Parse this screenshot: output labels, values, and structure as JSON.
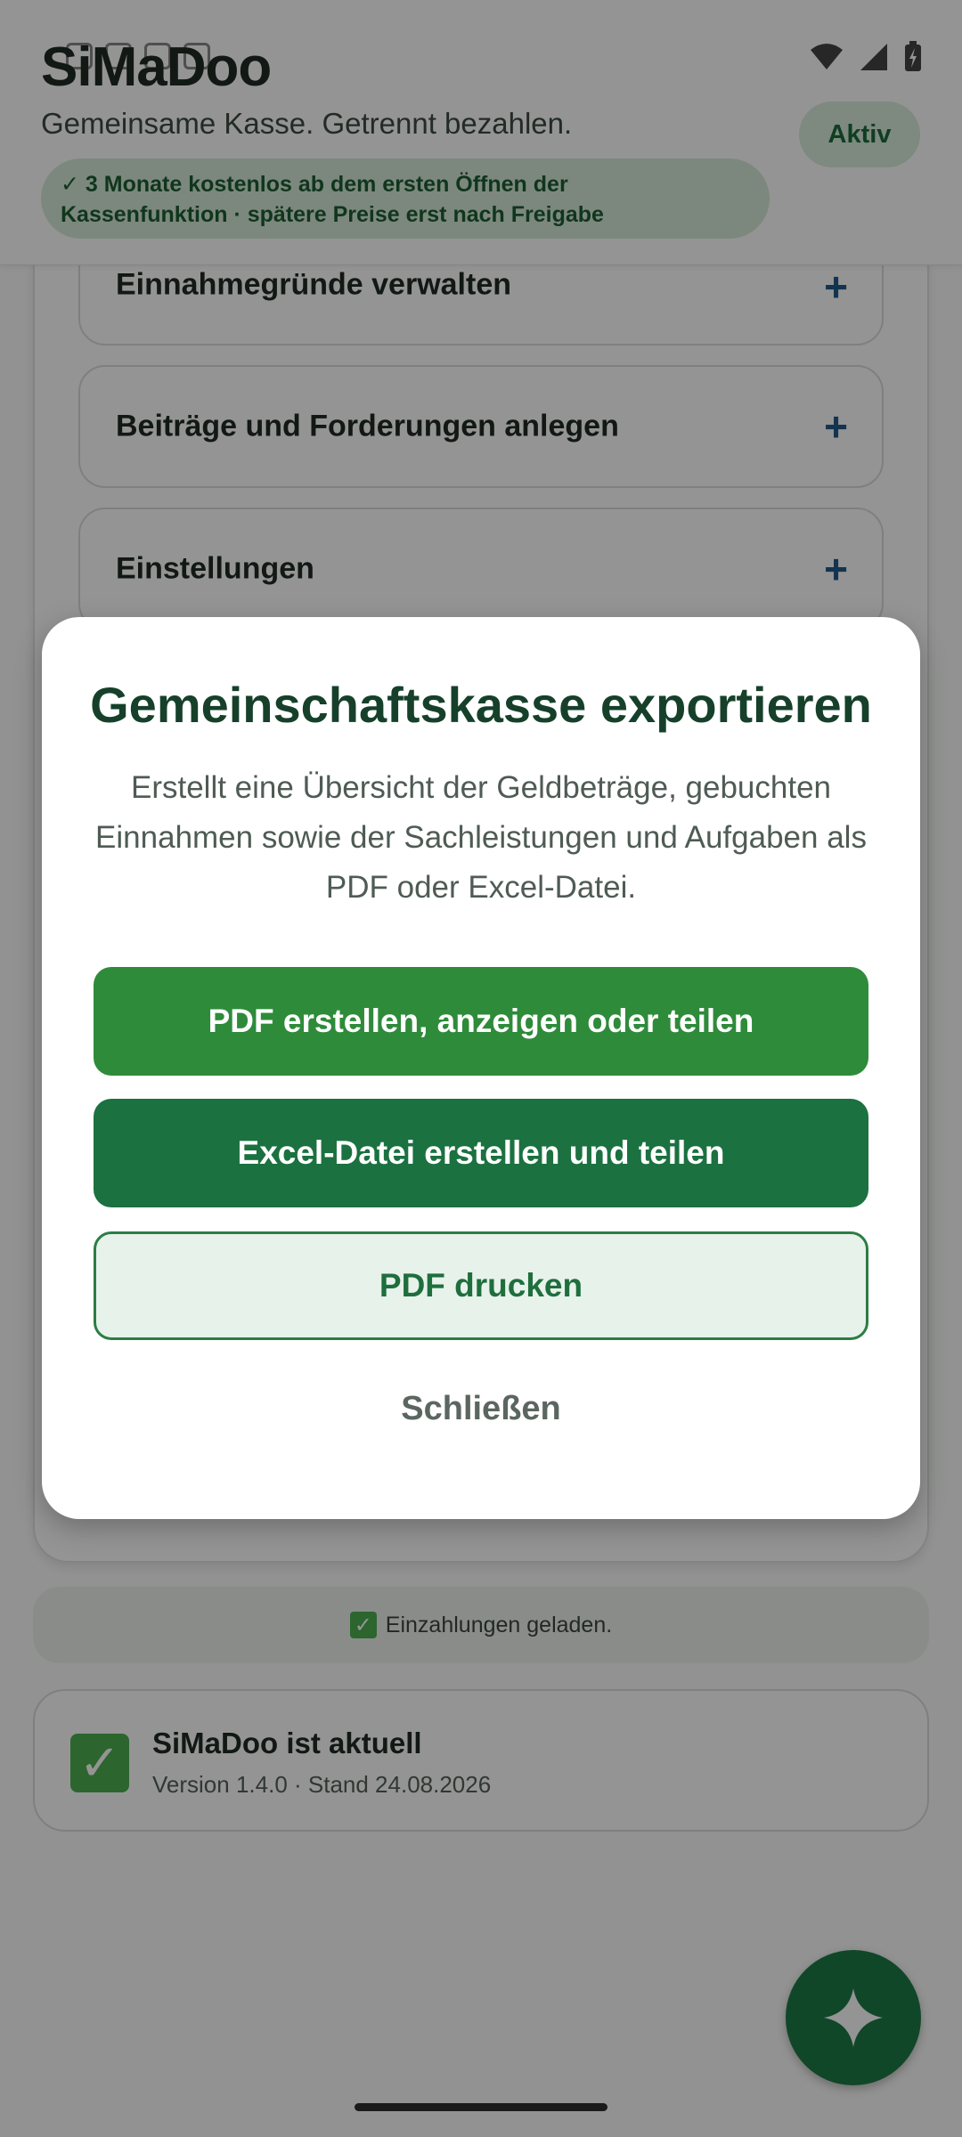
{
  "header": {
    "app_title": "SiMaDoo",
    "tagline": "Gemeinsame Kasse. Getrennt bezahlen.",
    "status_pill": "Aktiv",
    "promo_line1": "✓ 3 Monate kostenlos ab dem ersten Öffnen der",
    "promo_line2": "Kassenfunktion · spätere Preise erst nach Freigabe"
  },
  "accordion": {
    "items": [
      {
        "label": "Einnahmegründe verwalten",
        "icon": "plus-icon"
      },
      {
        "label": "Beiträge und Forderungen anlegen",
        "icon": "plus-icon"
      },
      {
        "label": "Einstellungen",
        "icon": "plus-icon"
      }
    ]
  },
  "toast": {
    "icon": "check-mark-emoji",
    "text": "Einzahlungen geladen."
  },
  "version_card": {
    "icon": "check-mark-emoji",
    "title": "SiMaDoo ist aktuell",
    "subtitle": "Version 1.4.0 · Stand 24.08.2026"
  },
  "fab": {
    "icon": "sparkle-icon"
  },
  "dialog": {
    "title": "Gemeinschaftskasse exportieren",
    "description": "Erstellt eine Übersicht der Geldbeträge, gebuchten Einnahmen sowie der Sachleistungen und Aufgaben als PDF oder Excel-Datei.",
    "pdf_button": "PDF erstellen, anzeigen oder teilen",
    "excel_button": "Excel-Datei erstellen und teilen",
    "print_button": "PDF drucken",
    "close_button": "Schließen"
  },
  "colors": {
    "primary_green": "#2e8b3a",
    "dark_green": "#1b7140",
    "accent_blue": "#1f5a8a"
  }
}
